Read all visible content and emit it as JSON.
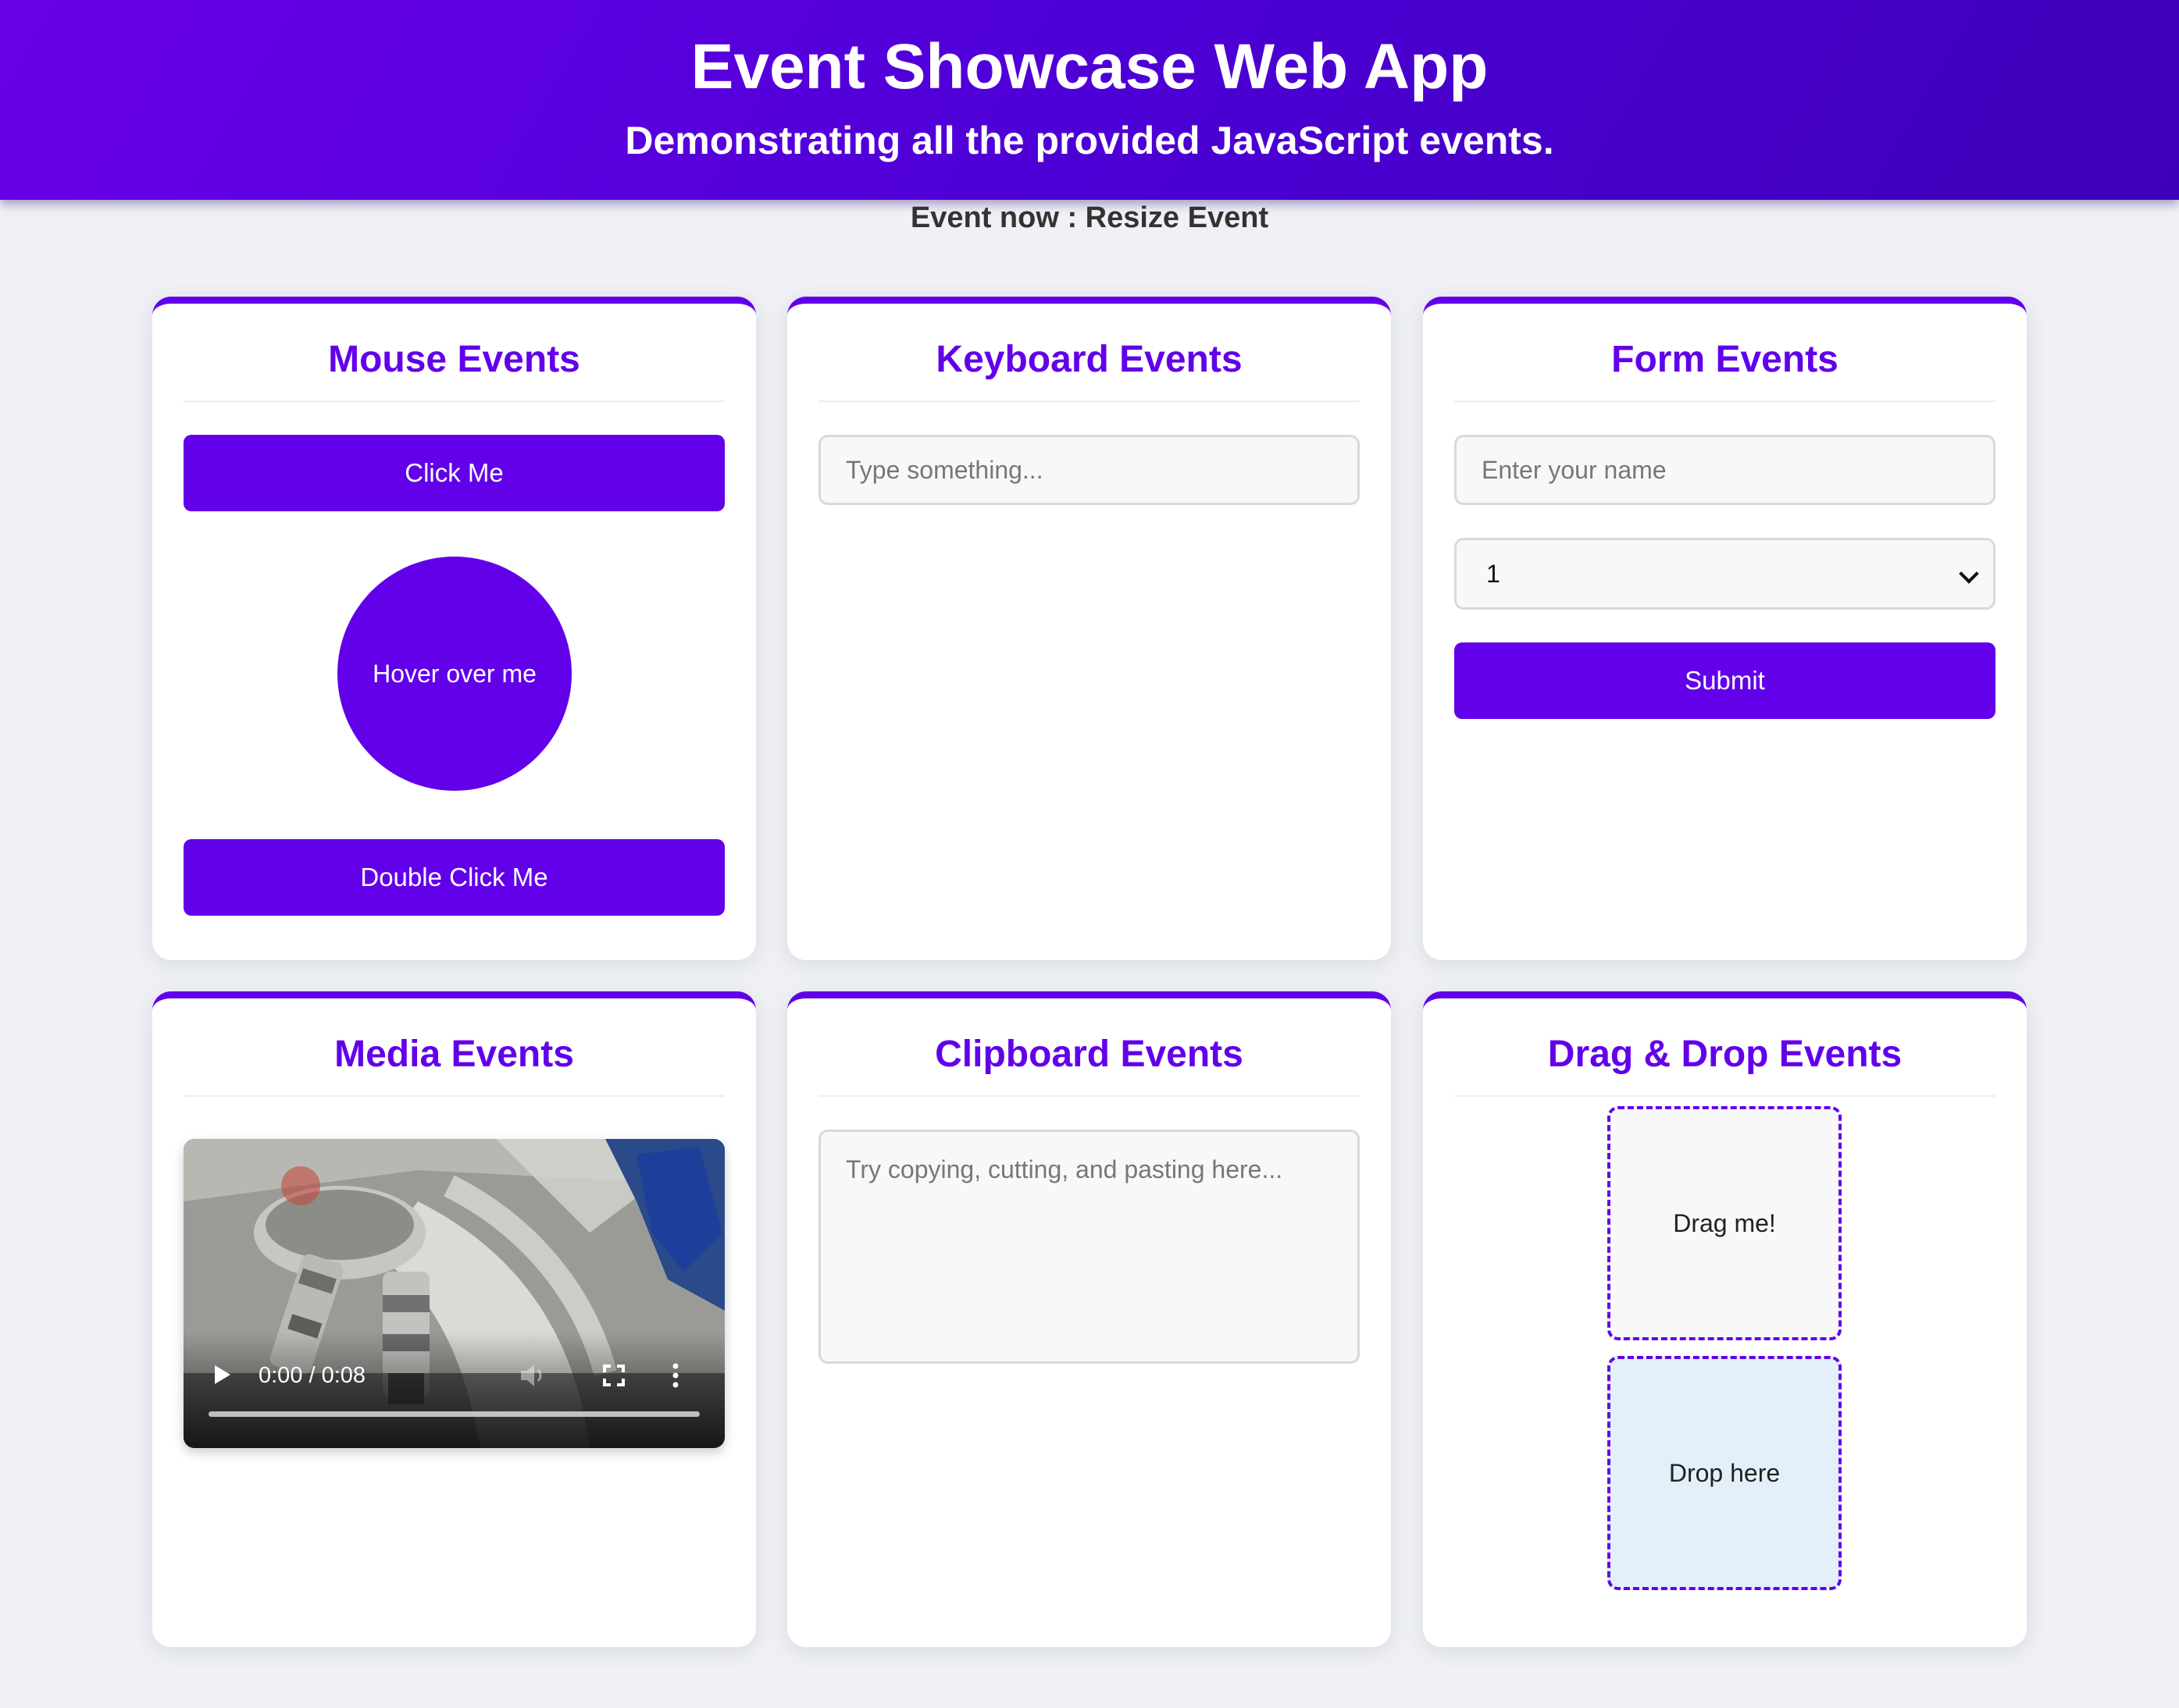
{
  "header": {
    "title": "Event Showcase Web App",
    "subtitle": "Demonstrating all the provided JavaScript events."
  },
  "status": "Event now : Resize Event",
  "mouse": {
    "title": "Mouse Events",
    "click_label": "Click Me",
    "hover_label": "Hover over me",
    "dblclick_label": "Double Click Me"
  },
  "keyboard": {
    "title": "Keyboard Events",
    "placeholder": "Type something..."
  },
  "form": {
    "title": "Form Events",
    "name_placeholder": "Enter your name",
    "select_value": "1",
    "submit_label": "Submit"
  },
  "media": {
    "title": "Media Events",
    "time": "0:00 / 0:08",
    "progress": 0
  },
  "clipboard": {
    "title": "Clipboard Events",
    "placeholder": "Try copying, cutting, and pasting here..."
  },
  "dnd": {
    "title": "Drag & Drop Events",
    "drag_label": "Drag me!",
    "drop_label": "Drop here"
  },
  "colors": {
    "accent": "#6200ea",
    "header_gradient_start": "#6a00e8",
    "header_gradient_end": "#3d00b8",
    "drop_zone": "#e3f0fa",
    "page_bg": "#eff1f6"
  },
  "icons": [
    "play-icon",
    "volume-icon",
    "fullscreen-icon",
    "more-options-icon",
    "chevron-down-icon"
  ]
}
